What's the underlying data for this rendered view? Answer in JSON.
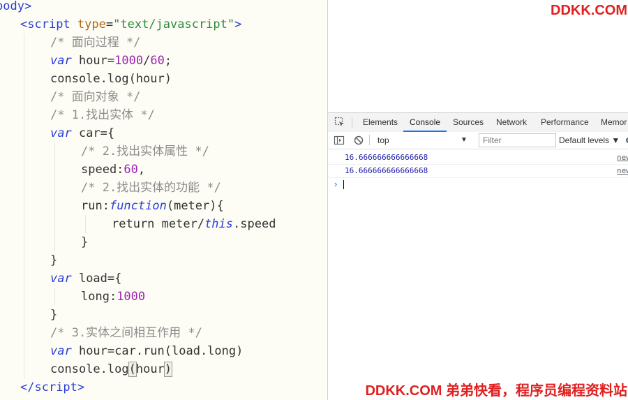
{
  "editor": {
    "lines": [
      [
        [
          "body&gt;",
          "tag"
        ]
      ],
      [
        [
          "<",
          "tag"
        ],
        [
          "script",
          "tag"
        ],
        [
          " ",
          "plain"
        ],
        [
          "type",
          "attr"
        ],
        [
          "=",
          "plain"
        ],
        [
          "\"text/javascript\"",
          "str"
        ],
        [
          ">",
          "tag"
        ]
      ],
      [
        [
          "/* 面向过程 */",
          "cm"
        ]
      ],
      [
        [
          "var",
          "kw"
        ],
        [
          " hour=",
          "plain"
        ],
        [
          "1000",
          "num"
        ],
        [
          "/",
          "plain"
        ],
        [
          "60",
          "num"
        ],
        [
          ";",
          "plain"
        ]
      ],
      [
        [
          "console.log(hour)",
          "plain"
        ]
      ],
      [
        [
          "/* 面向对象 */",
          "cm"
        ]
      ],
      [
        [
          "/* 1.找出实体 */",
          "cm"
        ]
      ],
      [
        [
          "var",
          "kw"
        ],
        [
          " car={",
          "plain"
        ]
      ],
      [
        [
          "/* 2.找出实体属性 */",
          "cm"
        ]
      ],
      [
        [
          "speed:",
          "plain"
        ],
        [
          "60",
          "num"
        ],
        [
          ",",
          "plain"
        ]
      ],
      [
        [
          "/* 2.找出实体的功能 */",
          "cm"
        ]
      ],
      [
        [
          "run:",
          "plain"
        ],
        [
          "function",
          "kw"
        ],
        [
          "(meter){",
          "plain"
        ]
      ],
      [
        [
          "return meter/",
          "plain"
        ],
        [
          "this",
          "kw"
        ],
        [
          ".speed",
          "plain"
        ]
      ],
      [
        [
          "}",
          "plain"
        ]
      ],
      [
        [
          "}",
          "plain"
        ]
      ],
      [
        [
          "var",
          "kw"
        ],
        [
          " load={",
          "plain"
        ]
      ],
      [
        [
          "long:",
          "plain"
        ],
        [
          "1000",
          "num"
        ]
      ],
      [
        [
          "}",
          "plain"
        ]
      ],
      [
        [
          "/* 3.实体之间相互作用 */",
          "cm"
        ]
      ],
      [
        [
          "var",
          "kw"
        ],
        [
          " hour=car.run(load.long)",
          "plain"
        ]
      ],
      [
        [
          "console.log",
          "plain"
        ],
        [
          "(",
          "hl"
        ],
        [
          "hour",
          "plain"
        ],
        [
          ")",
          "hl"
        ]
      ],
      [
        [
          "</",
          "tag"
        ],
        [
          "script",
          "tag"
        ],
        [
          ">",
          "tag"
        ]
      ]
    ]
  },
  "devtools": {
    "watermark_top": "DDKK.COM",
    "tabs": [
      "Elements",
      "Console",
      "Sources",
      "Network",
      "Performance",
      "Memor"
    ],
    "active_tab": "Console",
    "context": "top",
    "filter_placeholder": "Filter",
    "levels_label": "Default levels ▼",
    "logs": [
      {
        "value": "16.666666666666668",
        "source": "new"
      },
      {
        "value": "16.666666666666668",
        "source": "new"
      }
    ],
    "prompt_symbol": "›",
    "watermark_bottom": "DDKK.COM 弟弟快看，程序员编程资料站"
  },
  "colors": {
    "keyword": "#2a3fd6",
    "number": "#9c27b0",
    "string": "#2e8b3e",
    "comment": "#8c8c8c",
    "accent": "#1a73e8",
    "watermark": "#e02020"
  }
}
